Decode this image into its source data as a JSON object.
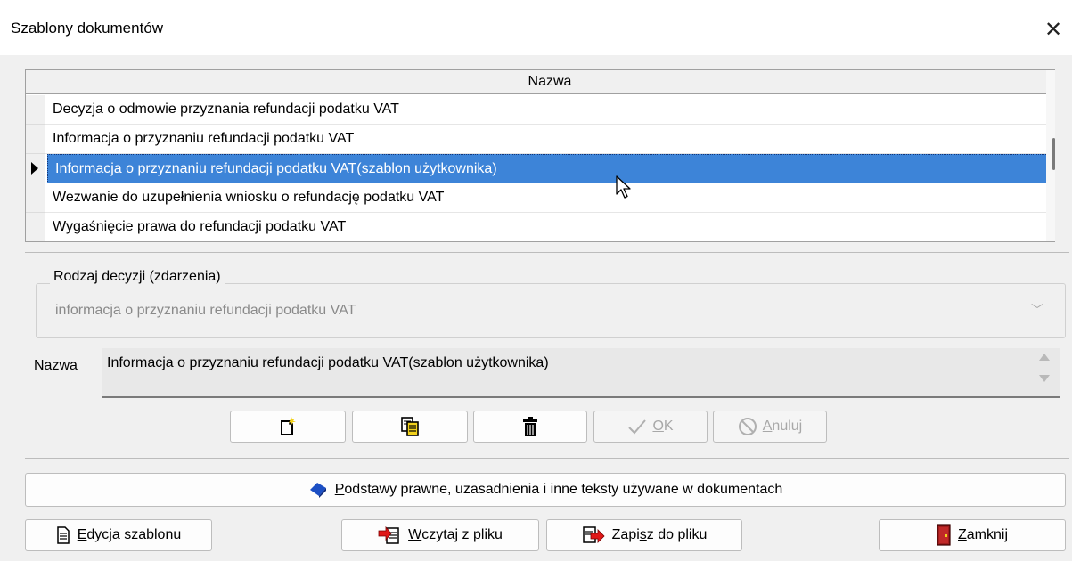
{
  "window": {
    "title": "Szablony dokumentów",
    "close_glyph": "✕"
  },
  "grid": {
    "header": "Nazwa",
    "rows": [
      "Decyzja o odmowie przyznania refundacji podatku VAT",
      "Informacja o przyznaniu refundacji podatku VAT",
      "Informacja o przyznaniu refundacji podatku VAT(szablon użytkownika)",
      "Wezwanie do uzupełnienia wniosku o refundację podatku VAT",
      "Wygaśnięcie prawa do refundacji podatku VAT"
    ],
    "selected_index": 2
  },
  "decision": {
    "group_label": "Rodzaj decyzji (zdarzenia)",
    "value": "informacja o przyznaniu refundacji podatku VAT"
  },
  "name_field": {
    "label": "Nazwa",
    "value": "Informacja o przyznaniu refundacji podatku VAT(szablon użytkownika)"
  },
  "toolbar": {
    "new_icon": "new-document-icon",
    "copy_icon": "copy-document-icon",
    "delete_icon": "trash-icon",
    "ok_label": "OK",
    "ok_underline": "O",
    "ok_rest": "K",
    "cancel_underline": "A",
    "cancel_rest": "nuluj"
  },
  "basis_button": {
    "underline": "P",
    "rest": "odstawy prawne, uzasadnienia i inne teksty używane w dokumentach"
  },
  "bottom": {
    "edit_underline": "E",
    "edit_rest": "dycja szablonu",
    "load_underline": "W",
    "load_rest": "czytaj z pliku",
    "save_pre": "Zapi",
    "save_underline": "s",
    "save_rest": "z do pliku",
    "close_underline": "Z",
    "close_rest": "amknij"
  },
  "colors": {
    "selection": "#3d84d8",
    "accent_blue": "#1c4fc4",
    "door_red": "#a01c1c"
  }
}
